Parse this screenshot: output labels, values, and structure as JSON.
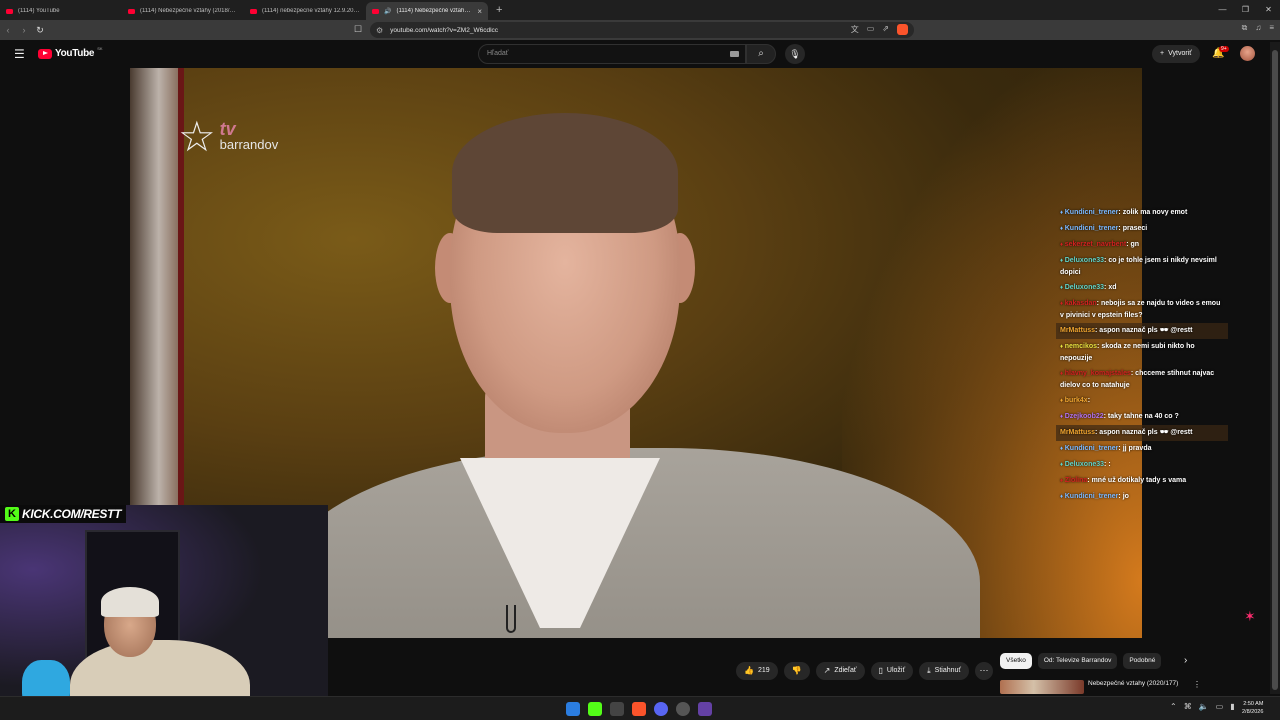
{
  "browser": {
    "tabs": [
      {
        "title": "(1114) YouTube",
        "active": false
      },
      {
        "title": "(1114) Nebezpečné vztahy (2018/17...",
        "active": false
      },
      {
        "title": "(1114) nebezpecne vztahy 12.9.2017",
        "active": false
      },
      {
        "title": "(1114) Nebezpečné vztahy (2...",
        "active": true
      }
    ],
    "new_tab": "+",
    "url": "youtube.com/watch?v=ZM2_W6cdlcc",
    "window_controls": [
      "—",
      "❐",
      "✕"
    ]
  },
  "youtube": {
    "logo_text": "YouTube",
    "country_code": "SK",
    "search_placeholder": "Hľadať",
    "create_label": "Vytvoriť",
    "notifications_badge": "9+"
  },
  "video": {
    "channel_logo_tv": "tv",
    "channel_logo_brand": "barrandov",
    "kick_label": "KICK.COM/RESTT"
  },
  "chat": [
    {
      "user": "Kundicni_trener",
      "user_color": "#7ab8ff",
      "message": "zolik ma novy emot",
      "highlight": false
    },
    {
      "user": "Kundicni_trener",
      "user_color": "#7ab8ff",
      "message": "praseci",
      "highlight": false
    },
    {
      "user": "sekerzet_navrbent",
      "user_color": "#d12020",
      "message": "gn",
      "highlight": false
    },
    {
      "user": "Deluxone33",
      "user_color": "#5fd3c8",
      "message": "co je tohle jsem si nikdy nevsiml dopici",
      "highlight": false
    },
    {
      "user": "Deluxone33",
      "user_color": "#5fd3c8",
      "message": "xd",
      "highlight": false
    },
    {
      "user": "kakasdan",
      "user_color": "#d12020",
      "message": "nebojis sa ze najdu to video s emou v pivinici v epstein files?",
      "highlight": false
    },
    {
      "user": "MrMattuss",
      "user_color": "#f0a530",
      "message": "aspon naznač pls 🕶 @restt",
      "highlight": true
    },
    {
      "user": "nemcikos",
      "user_color": "#e6e040",
      "message": "skoda ze nemi subi nikto ho nepouzije",
      "highlight": false
    },
    {
      "user": "hlavny_komajstales",
      "user_color": "#d12020",
      "message": "chcceme stihnut najvac dielov co to natahuje",
      "highlight": false
    },
    {
      "user": "burk4x",
      "user_color": "#f0a530",
      "message": "",
      "highlight": false
    },
    {
      "user": "Dzejkoob22",
      "user_color": "#b070f0",
      "message": "taky tahne na 40 co ?",
      "highlight": false
    },
    {
      "user": "MrMattuss",
      "user_color": "#f0a530",
      "message": "aspon naznač pls 🕶 @restt",
      "highlight": true
    },
    {
      "user": "Kundicni_trener",
      "user_color": "#7ab8ff",
      "message": "jj pravda",
      "highlight": false
    },
    {
      "user": "Deluxone33",
      "user_color": "#5fd3c8",
      "message": ":",
      "highlight": false
    },
    {
      "user": "Zlolina",
      "user_color": "#d12020",
      "message": "mné už dotikaly tady s vama",
      "highlight": false
    },
    {
      "user": "Kundicni_trener",
      "user_color": "#7ab8ff",
      "message": "jo",
      "highlight": false
    }
  ],
  "actions": {
    "like_count": "219",
    "share": "Zdieľať",
    "save": "Uložiť",
    "download": "Stiahnuť"
  },
  "chips": [
    "Všetko",
    "Od: Televize Barrandov",
    "Podobné"
  ],
  "recommendation": {
    "title": "Nebezpečné vztahy (2020/177)"
  },
  "taskbar": {
    "time": "2:50 AM",
    "date": "2/8/2026"
  },
  "colors": {
    "accent": "#ff0033",
    "kick_green": "#53fc18"
  }
}
